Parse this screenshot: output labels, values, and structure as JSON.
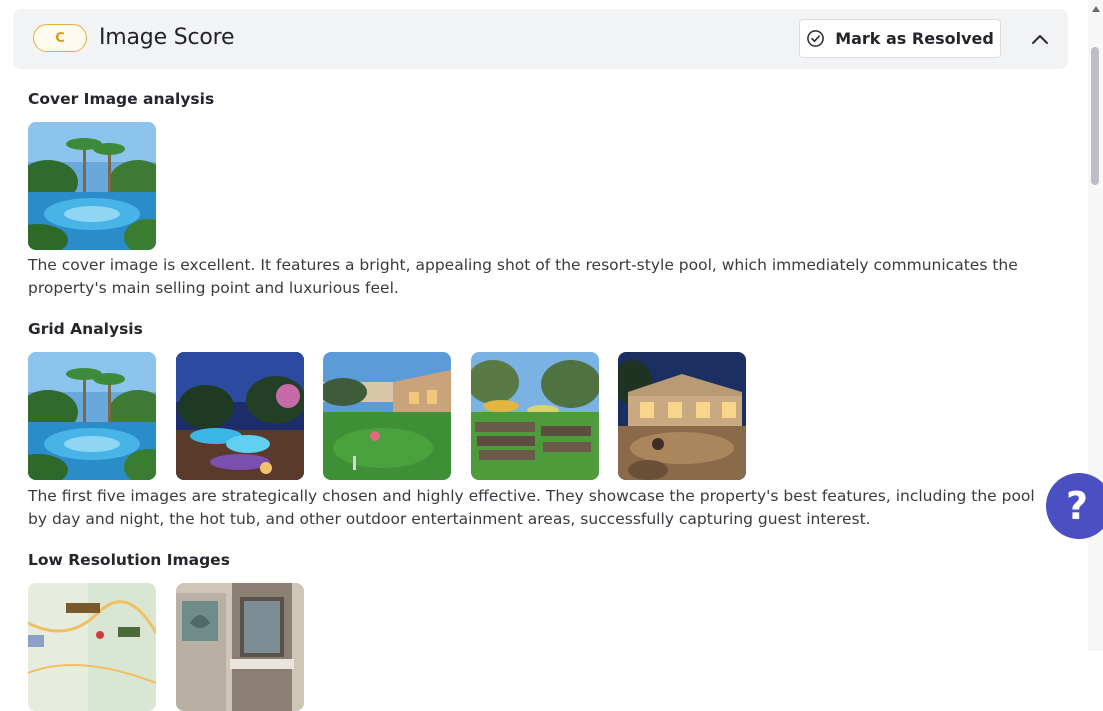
{
  "header": {
    "grade": "C",
    "title": "Image Score",
    "resolve_label": "Mark as Resolved"
  },
  "cover": {
    "title": "Cover Image analysis",
    "text": "The cover image is excellent. It features a bright, appealing shot of the resort-style pool, which immediately communicates the property's main selling point and luxurious feel."
  },
  "grid": {
    "title": "Grid Analysis",
    "text": "The first five images are strategically chosen and highly effective. They showcase the property's best features, including the pool by day and night, the hot tub, and other outdoor entertainment areas, successfully capturing guest interest."
  },
  "lowres": {
    "title": "Low Resolution Images"
  },
  "help": {
    "label": "?"
  },
  "colors": {
    "accent": "#4b4fc4",
    "grade": "#e3b23c"
  }
}
